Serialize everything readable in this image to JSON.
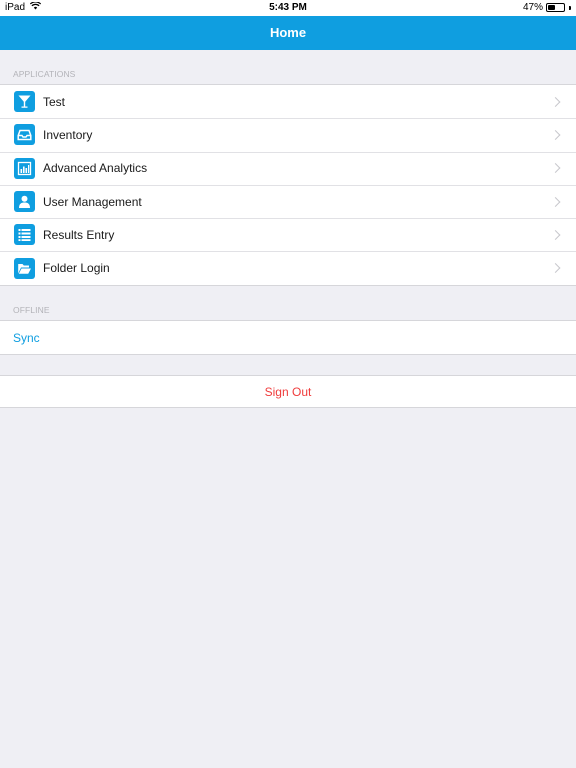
{
  "status_bar": {
    "device": "iPad",
    "time": "5:43 PM",
    "battery": "47%",
    "battery_level": 0.47
  },
  "nav": {
    "title": "Home"
  },
  "applications": {
    "header": "APPLICATIONS",
    "items": [
      {
        "label": "Test",
        "icon": "cocktail-glass-icon"
      },
      {
        "label": "Inventory",
        "icon": "inbox-tray-icon"
      },
      {
        "label": "Advanced Analytics",
        "icon": "bar-chart-icon"
      },
      {
        "label": "User Management",
        "icon": "user-icon"
      },
      {
        "label": "Results Entry",
        "icon": "list-icon"
      },
      {
        "label": "Folder Login",
        "icon": "folder-open-icon"
      }
    ]
  },
  "offline": {
    "header": "OFFLINE",
    "sync_label": "Sync"
  },
  "sign_out": {
    "label": "Sign Out"
  },
  "colors": {
    "accent": "#0f9ee0",
    "destructive": "#ef3b3b",
    "background": "#efeff4"
  }
}
